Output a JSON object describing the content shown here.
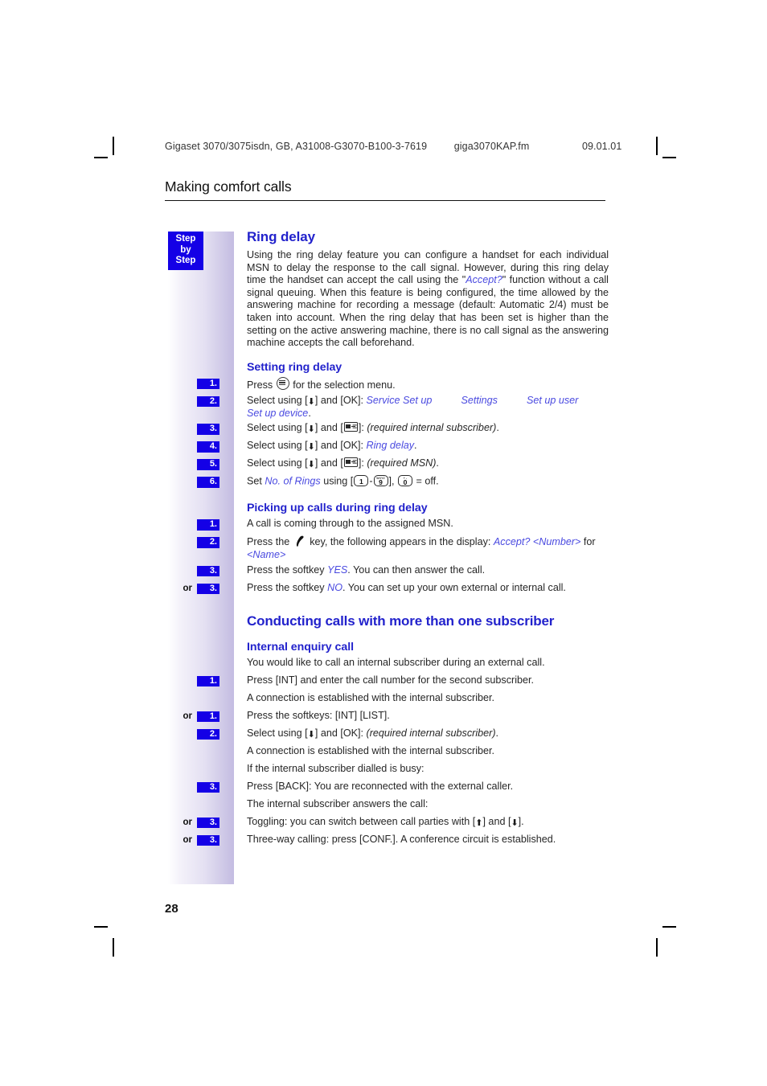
{
  "running_head": {
    "document": "Gigaset 3070/3075isdn, GB, A31008-G3070-B100-3-7619",
    "file": "giga3070KAP.fm",
    "date": "09.01.01"
  },
  "chapter_title": "Making comfort calls",
  "margin_tab": {
    "line1": "Step",
    "line2": "by",
    "line3": "Step"
  },
  "page_number": "28",
  "colors": {
    "heading_blue": "#2222cc",
    "chip_blue": "#1400e6",
    "inline_blue": "#4a4ae0"
  },
  "sections": [
    {
      "heading": "Ring delay",
      "intro": "Using the ring delay feature you can configure a handset for each individual MSN to delay the response to the call signal. However, during this ring delay time the handset can accept the call using the \"Accept?\" function without a call signal queuing. When this feature is being configured, the time allowed by the answering machine for recording a message (default: Automatic 2/4) must be taken into account. When the ring delay that has been set is higher than the setting on the active answering machine, there is no call signal as the answering machine accepts the call beforehand.",
      "intro_emph": "Accept?",
      "subsections": [
        {
          "heading": "Setting ring delay",
          "steps": [
            {
              "num": "1.",
              "or": "",
              "text_before": "Press ",
              "icon": "menu-icon",
              "text_after": " for the selection menu."
            },
            {
              "num": "2.",
              "or": "",
              "lead": "Select using [",
              "arrow": "down-arrow-icon",
              "mid": "] and [OK]: ",
              "menu_path": [
                "Service Set up",
                "Settings",
                "Set up user",
                "Set up device"
              ],
              "trail": "."
            },
            {
              "num": "3.",
              "or": "",
              "lead": "Select using [",
              "arrow": "down-arrow-icon",
              "mid": "] and [",
              "key": "display-key-icon",
              "after": "]: ",
              "italic": "(required internal subscriber)",
              "trail": "."
            },
            {
              "num": "4.",
              "or": "",
              "lead": "Select using [",
              "arrow": "down-arrow-icon",
              "mid": "] and [OK]: ",
              "blue_italic": "Ring delay",
              "trail": "."
            },
            {
              "num": "5.",
              "or": "",
              "lead": "Select using [",
              "arrow": "down-arrow-icon",
              "mid": "] and [",
              "key": "display-key-icon",
              "after": "]: ",
              "italic": "(required MSN)",
              "trail": "."
            },
            {
              "num": "6.",
              "or": "",
              "lead": "Set ",
              "blue_italic": "No. of Rings",
              "mid": " using [",
              "digit_from": "1",
              "digit_dash": "-",
              "digit_to": "9",
              "digit_to_sup": "WXYZ",
              "after": "], ",
              "digit_off": "0",
              "digit_off_sup": "+ -",
              "trail": " = off."
            }
          ]
        },
        {
          "heading": "Picking up calls during ring delay",
          "steps": [
            {
              "num": "1.",
              "or": "",
              "plain": "A call is coming through to the assigned MSN."
            },
            {
              "num": "2.",
              "or": "",
              "lead": "Press the ",
              "icon": "phone-handset-icon",
              "mid": " key, the following appears in the display: ",
              "blue_italic": "Accept? <Number>",
              "after": " for ",
              "blue_italic2": "<Name>"
            },
            {
              "num": "3.",
              "or": "",
              "lead": "Press the softkey ",
              "blue_italic": "YES",
              "trail": ". You can then answer the call."
            },
            {
              "num": "3.",
              "or": "or",
              "lead": "Press the softkey ",
              "blue_italic": "NO",
              "trail": ". You can set up your own external or internal call."
            }
          ]
        }
      ]
    },
    {
      "heading": "Conducting calls with more than one subscriber",
      "subsections": [
        {
          "heading": "Internal enquiry call",
          "steps": [
            {
              "num": "",
              "or": "",
              "plain": "You would like to call an internal subscriber during an external call."
            },
            {
              "num": "1.",
              "or": "",
              "plain": "Press [INT] and enter the call number for the second subscriber."
            },
            {
              "num": "",
              "or": "",
              "plain": "A connection is established with the internal subscriber."
            },
            {
              "num": "1.",
              "or": "or",
              "plain": "Press the softkeys: [INT]     [LIST]."
            },
            {
              "num": "2.",
              "or": "",
              "lead": "Select using [",
              "arrow": "down-arrow-icon",
              "mid": "] and [OK]: ",
              "italic": "(required internal subscriber)",
              "trail": "."
            },
            {
              "num": "",
              "or": "",
              "plain": "A connection is established with the internal subscriber."
            },
            {
              "num": "",
              "or": "",
              "plain": "If the internal subscriber dialled is busy:"
            },
            {
              "num": "3.",
              "or": "",
              "plain": "Press [BACK]: You are reconnected with the external caller."
            },
            {
              "num": "",
              "or": "",
              "plain": "The internal subscriber answers the call:"
            },
            {
              "num": "3.",
              "or": "or",
              "lead": "Toggling: you can switch between call parties with [",
              "arrow_up": "up-arrow-icon",
              "mid": "] and [",
              "arrow": "down-arrow-icon",
              "trail": "]."
            },
            {
              "num": "3.",
              "or": "or",
              "plain": "Three-way calling: press [CONF.]. A conference circuit is established."
            }
          ]
        }
      ]
    }
  ]
}
